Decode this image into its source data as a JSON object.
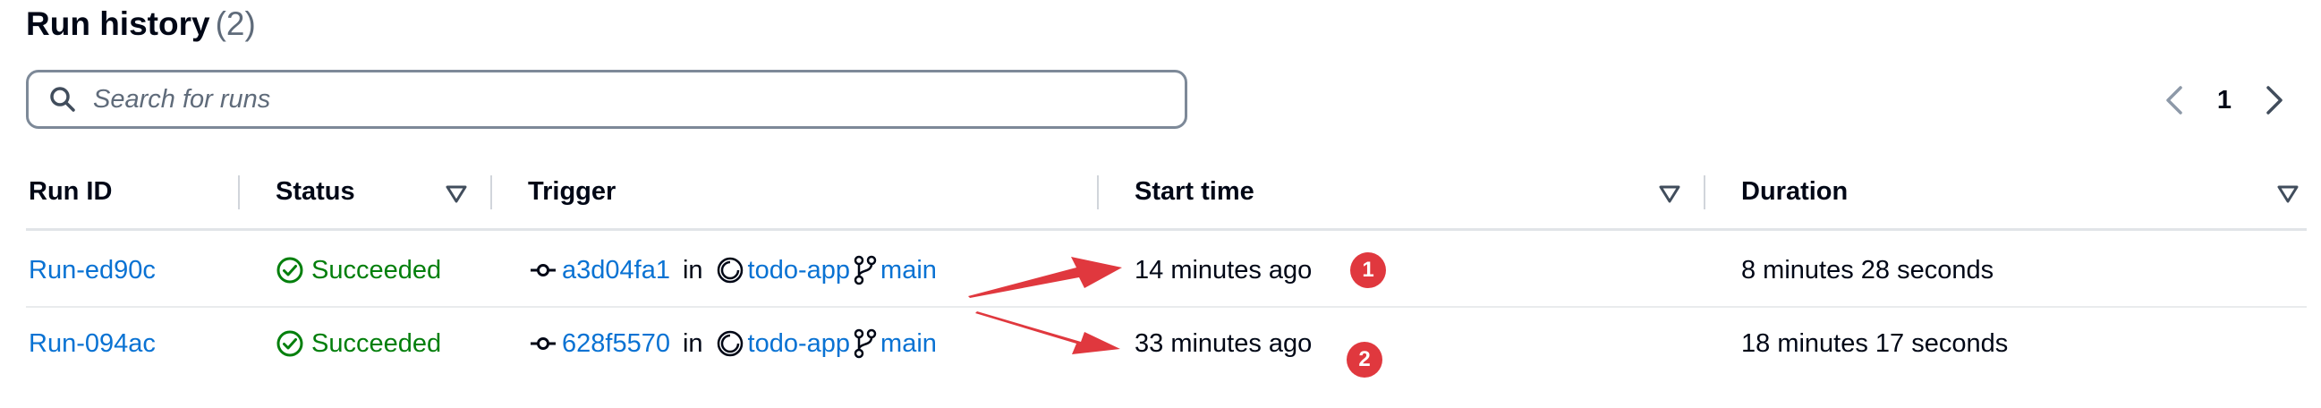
{
  "header": {
    "title": "Run history",
    "count": "(2)"
  },
  "search": {
    "placeholder": "Search for runs",
    "value": ""
  },
  "pagination": {
    "current_page": "1"
  },
  "table": {
    "columns": [
      "Run ID",
      "Status",
      "Trigger",
      "Start time",
      "Duration"
    ],
    "rows": [
      {
        "run_id": "Run-ed90c",
        "status": "Succeeded",
        "commit": "a3d04fa1",
        "in": "in",
        "repo": "todo-app",
        "branch": "main",
        "start_time": "14 minutes ago",
        "duration": "8 minutes 28 seconds"
      },
      {
        "run_id": "Run-094ac",
        "status": "Succeeded",
        "commit": "628f5570",
        "in": "in",
        "repo": "todo-app",
        "branch": "main",
        "start_time": "33 minutes ago",
        "duration": "18 minutes 17 seconds"
      }
    ]
  },
  "annotations": [
    {
      "label": "1",
      "color": "#e0383e"
    },
    {
      "label": "2",
      "color": "#e0383e"
    }
  ],
  "colors": {
    "link": "#0972d3",
    "success": "#037f0c",
    "annotation": "#e0383e"
  },
  "icons": [
    "search-icon",
    "chevron-left-icon",
    "chevron-right-icon",
    "sort-caret-icon",
    "success-check-icon",
    "commit-icon",
    "repository-icon",
    "branch-icon",
    "annotation-arrow-icon"
  ]
}
